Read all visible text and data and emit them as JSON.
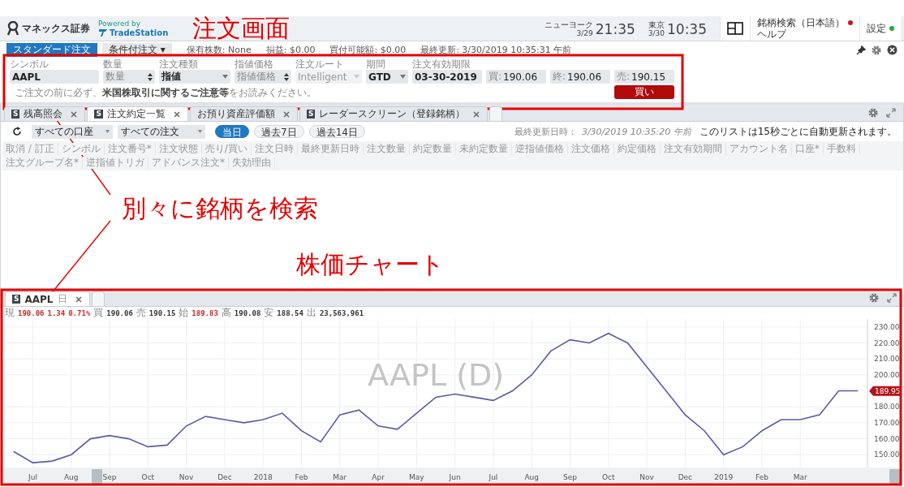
{
  "header": {
    "logo": "マネックス証券",
    "powered_by": "Powered by",
    "partner": "TradeStation",
    "clocks": [
      {
        "city": "ニューヨーク",
        "date": "3/29",
        "time": "21:35"
      },
      {
        "city": "東京",
        "date": "3/30",
        "time": "10:35"
      }
    ],
    "symbol_search": {
      "label": "銘柄検索（日本語）",
      "color": "#d0102a"
    },
    "help": "ヘルプ",
    "settings": {
      "label": "設定",
      "color": "#22aa33"
    }
  },
  "order_panel": {
    "tabs": [
      {
        "label": "スタンダード注文",
        "selected": true
      },
      {
        "label": "条件付注文 ▾",
        "selected": false
      }
    ],
    "info": [
      "保有株数: None",
      "損益: $0.00",
      "買付可能額: $0.00",
      "最終更新: 3/30/2019 10:35:31 午前"
    ],
    "fields": [
      {
        "label": "シンボル",
        "kind": "text",
        "value": "AAPL",
        "disabled": false
      },
      {
        "label": "数量",
        "kind": "spinner",
        "placeholder": "数量",
        "disabled": false
      },
      {
        "label": "注文種類",
        "kind": "select",
        "value": "指値",
        "disabled": false
      },
      {
        "label": "指値価格",
        "kind": "spinner",
        "placeholder": "指値価格",
        "disabled": false
      },
      {
        "label": "注文ルート",
        "kind": "select",
        "value": "Intelligent",
        "disabled": true
      },
      {
        "label": "期間",
        "kind": "select",
        "value": "GTD",
        "disabled": false
      },
      {
        "label": "注文有効期限",
        "kind": "text",
        "value": "03-30-2019",
        "disabled": false
      },
      {
        "kind": "quote",
        "prefix": "買:",
        "value": "190.06",
        "disabled": false
      },
      {
        "kind": "quote",
        "prefix": "終:",
        "value": "190.06",
        "disabled": false
      },
      {
        "kind": "quote",
        "prefix": "売:",
        "value": "190.15",
        "disabled": false
      }
    ],
    "note": "ご注文の前に必ず、**米国株取引に関するご注意等**をお読みください。",
    "buy_button": "買い"
  },
  "orders_panel": {
    "tabs": [
      {
        "badge": "S",
        "label": "残高照会",
        "selected": false
      },
      {
        "badge": "S",
        "label": "注文約定一覧",
        "selected": true
      },
      {
        "label": "お預り資産評価額",
        "selected": false
      },
      {
        "badge": "S",
        "label": "レーダースクリーン（登録銘柄）",
        "selected": false
      }
    ],
    "filters": [
      "すべての口座",
      "すべての注文"
    ],
    "periods": [
      {
        "label": "当日",
        "selected": true
      },
      {
        "label": "過去7日",
        "selected": false
      },
      {
        "label": "過去14日",
        "selected": false
      }
    ],
    "last_updated_label": "最終更新日時：",
    "last_updated": "3/30/2019 10:35:20 午前",
    "auto_refresh_note": "このリストは15秒ごとに自動更新されます。",
    "columns": [
      "取消 / 訂正",
      "シンボル",
      "注文番号*",
      "注文状態",
      "売り/買い",
      "注文日時",
      "最終更新日時",
      "注文数量",
      "約定数量",
      "未約定数量",
      "逆指値価格",
      "注文価格",
      "約定価格",
      "注文有効期間",
      "アカウント名",
      "口座*",
      "手数料",
      "注文グループ名*",
      "逆指値トリガ",
      "アドバンス注文*",
      "失効理由"
    ]
  },
  "chart_panel": {
    "tab": {
      "badge": "S",
      "symbol": "AAPL",
      "interval": "日"
    },
    "quote": [
      {
        "label": "現",
        "values": [
          "190.06",
          "1.34",
          "0.71%"
        ],
        "highlight": true
      },
      {
        "label": "買",
        "values": [
          "190.06"
        ],
        "highlight": false
      },
      {
        "label": "売",
        "values": [
          "190.15"
        ],
        "highlight": false
      },
      {
        "label": "始",
        "values": [
          "189.83"
        ],
        "highlight": true
      },
      {
        "label": "高",
        "values": [
          "190.08"
        ],
        "highlight": false
      },
      {
        "label": "安",
        "values": [
          "188.54"
        ],
        "highlight": false
      },
      {
        "label": "出",
        "values": [
          "23,563,961"
        ],
        "highlight": false
      }
    ],
    "price_marker": "189.95",
    "chart_data": {
      "type": "line",
      "title": "AAPL (D)",
      "grid": true,
      "categories": [
        null,
        "Jul",
        null,
        "Aug",
        null,
        "Sep",
        null,
        "Oct",
        null,
        "Nov",
        null,
        "Dec",
        null,
        "2018",
        null,
        "Feb",
        null,
        "Mar",
        null,
        "Apr",
        null,
        "May",
        null,
        "Jun",
        null,
        "Jul",
        null,
        "Aug",
        null,
        "Sep",
        null,
        "Oct",
        null,
        "Nov",
        null,
        "Dec",
        null,
        "2019",
        null,
        "Feb",
        null,
        "Mar",
        null,
        null,
        null
      ],
      "series": [
        {
          "color": "#5a5aa8",
          "values": [
            152,
            145,
            146,
            150,
            160,
            162,
            160,
            155,
            156,
            168,
            174,
            172,
            170,
            172,
            176,
            165,
            158,
            175,
            178,
            168,
            166,
            176,
            186,
            188,
            186,
            184,
            190,
            200,
            215,
            222,
            220,
            226,
            220,
            205,
            190,
            175,
            165,
            150,
            155,
            165,
            172,
            172,
            175,
            190,
            190
          ]
        }
      ],
      "ylim": [
        143,
        234
      ],
      "yticks": [
        {
          "value": 150,
          "label": "150.00"
        },
        {
          "value": 160,
          "label": "160.00"
        },
        {
          "value": 170,
          "label": "170.00"
        },
        {
          "value": 180,
          "label": "180.00"
        },
        {
          "value": 200,
          "label": "200.00"
        },
        {
          "value": 210,
          "label": "210.00"
        },
        {
          "value": 220,
          "label": "220.00"
        },
        {
          "value": 230,
          "label": "230.00"
        }
      ]
    }
  },
  "annotations": [
    {
      "kind": "label",
      "text": "注文画面"
    },
    {
      "kind": "label",
      "text": "別々に銘柄を検索"
    },
    {
      "kind": "label",
      "text": "株価チャート"
    }
  ]
}
